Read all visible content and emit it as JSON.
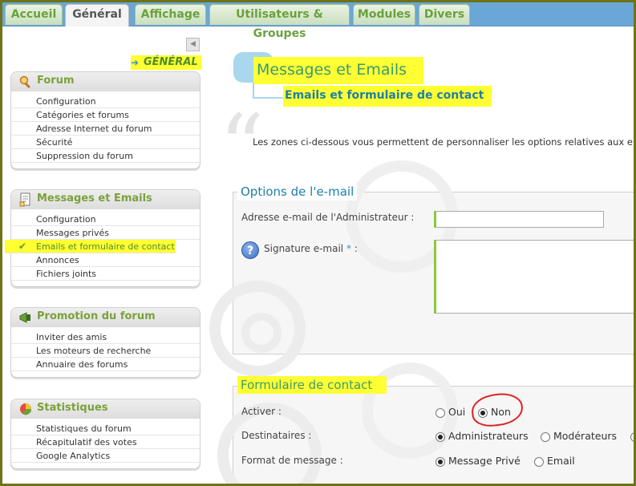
{
  "tabs": [
    {
      "label": "Accueil",
      "active": false
    },
    {
      "label": "Général",
      "active": true
    },
    {
      "label": "Affichage",
      "active": false
    },
    {
      "label": "Utilisateurs & Groupes",
      "active": false
    },
    {
      "label": "Modules",
      "active": false
    },
    {
      "label": "Divers",
      "active": false
    }
  ],
  "sidebar": {
    "collapse_icon": "◀",
    "section_link": "GÉNÉRAL",
    "panels": [
      {
        "title": "Forum",
        "icon": "search-wrench-icon",
        "items": [
          "Configuration",
          "Catégories et forums",
          "Adresse Internet du forum",
          "Sécurité",
          "Suppression du forum"
        ]
      },
      {
        "title": "Messages et Emails",
        "icon": "document-icon",
        "items": [
          "Configuration",
          "Messages privés",
          "Emails et formulaire de contact",
          "Annonces",
          "Fichiers joints"
        ],
        "active_index": 2
      },
      {
        "title": "Promotion du forum",
        "icon": "megaphone-icon",
        "items": [
          "Inviter des amis",
          "Les moteurs de recherche",
          "Annuaire des forums"
        ]
      },
      {
        "title": "Statistiques",
        "icon": "pie-chart-icon",
        "items": [
          "Statistiques du forum",
          "Récapitulatif des votes",
          "Google Analytics"
        ]
      }
    ]
  },
  "main": {
    "title": "Messages et Emails",
    "subtitle": "Emails et formulaire de contact",
    "intro": "Les zones ci-dessous vous permettent de personnaliser les options relatives aux e",
    "email_options": {
      "legend": "Options de l'e-mail",
      "admin_email_label": "Adresse e-mail de l'Administrateur :",
      "admin_email_value": "",
      "signature_label_prefix": "Signature e-mail ",
      "signature_required_mark": "*",
      "signature_label_suffix": " :",
      "signature_value": "",
      "help_icon": "?"
    },
    "contact_form": {
      "legend": "Formulaire de contact",
      "activate_label": "Activer :",
      "activate_options": [
        "Oui",
        "Non"
      ],
      "activate_selected": "Non",
      "recipients_label": "Destinataires :",
      "recipients_options": [
        "Administrateurs",
        "Modérateurs"
      ],
      "recipients_selected": "Administrateurs",
      "format_label": "Format de message :",
      "format_options": [
        "Message Privé",
        "Email"
      ],
      "format_selected": "Message Privé"
    }
  },
  "colors": {
    "highlight": "#ffff33",
    "accent_green": "#7ca13a",
    "accent_blue": "#1f7fa6",
    "annotation_red": "#d22222",
    "tab_bar": "#6aa6d8"
  }
}
